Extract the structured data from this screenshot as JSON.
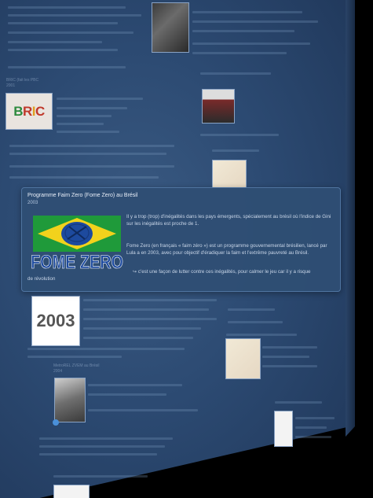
{
  "popup": {
    "title": "Programme Faim Zero (Fome Zero) au Brésil",
    "year": "2003",
    "paragraph1": "Il y a trop (trop) d'inégalités dans les pays émergents, spécialement au brésil où l'indice de Gini sur les inégalités est proche de 1.",
    "paragraph2": "Fome Zero (en français « faim zéro ») est un programme gouvernemental brésilien, lancé par Lula a en 2003, avec pour objectif d'éradiquer la faim et l'extrême pauvreté au Brésil.",
    "paragraph3_arrow": "↪",
    "paragraph3": "c'est une façon de lutter contre ces inégalités, pour calmer le jeu car il y a risque",
    "paragraph3_end": "de révolution",
    "logo_text": "FOME ZERO"
  },
  "background_nodes": {
    "brics_label": "BRIC (fait les PBC",
    "brics_year": "2001",
    "brics_thumb_text": "BRIC",
    "year_thumb_text": "2003",
    "metro_label": "MetroREL ZVEM au Brésil",
    "metro_year": "2004"
  },
  "colors": {
    "canvas": "#2c4a72",
    "popup": "#2f4e74",
    "brics_b": "#2d8a3e",
    "brics_r": "#c0392b",
    "brics_i": "#e0a020",
    "brics_c": "#c0392b",
    "logo_green": "#1f9a3a",
    "logo_yellow": "#f2d21c",
    "logo_blue": "#1d4a9e"
  }
}
